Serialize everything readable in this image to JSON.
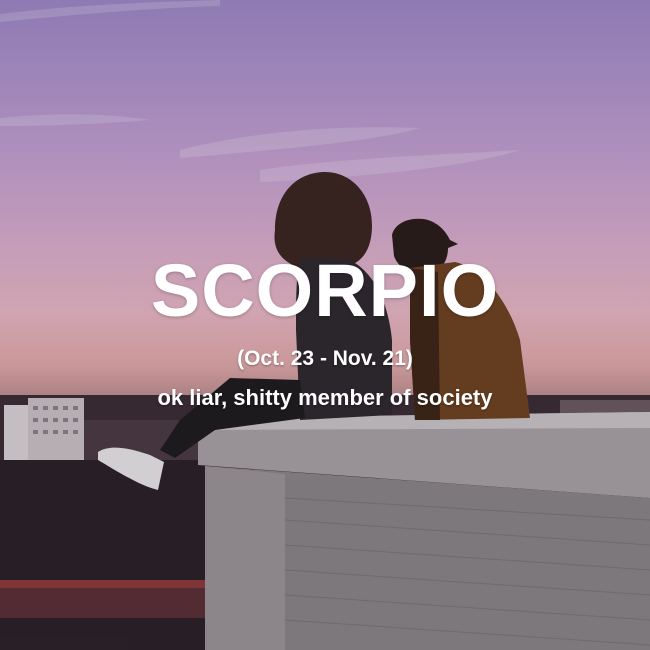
{
  "sign": {
    "name": "SCORPIO",
    "dates": "(Oct. 23 - Nov. 21)",
    "description": "ok liar, shitty member of society"
  },
  "palette": {
    "sky_top": "#9d87c4",
    "sky_pink": "#e6b6c2",
    "text": "#ffffff"
  }
}
